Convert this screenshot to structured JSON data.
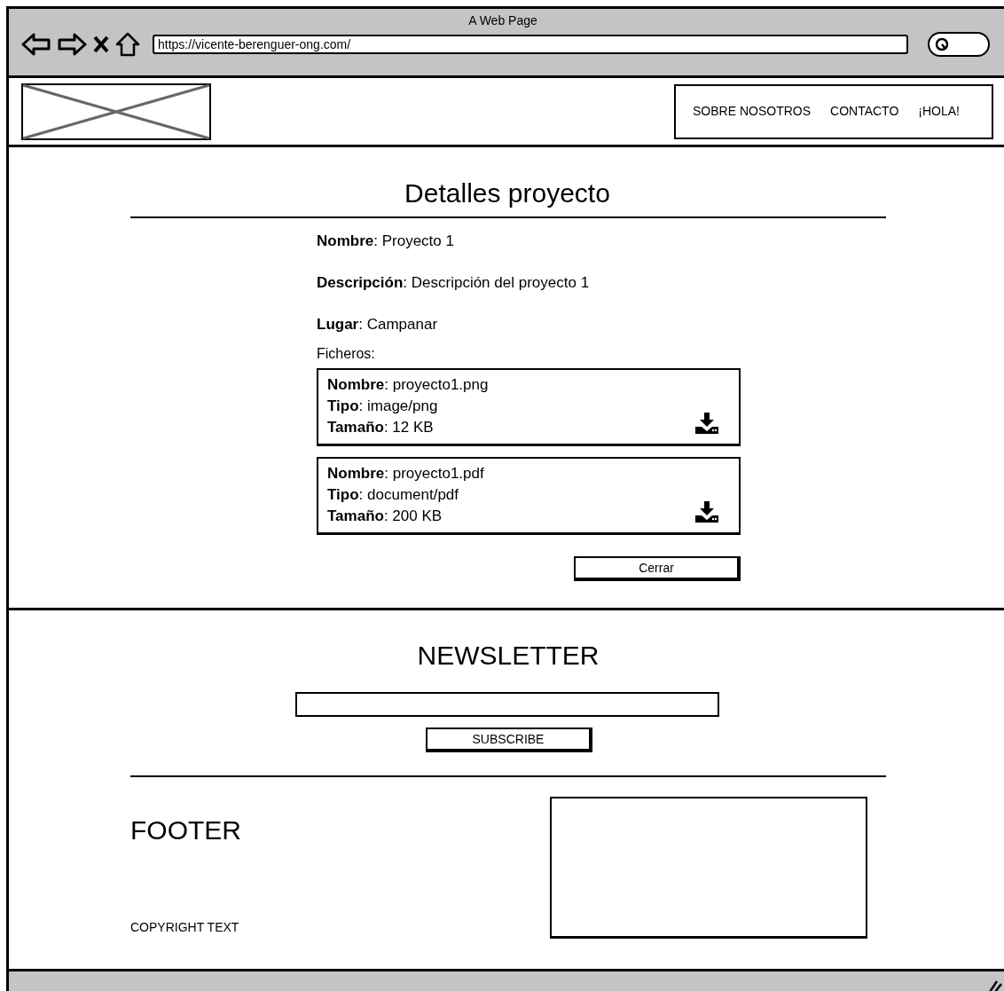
{
  "window": {
    "title": "A Web Page",
    "url": "https://vicente-berenguer-ong.com/"
  },
  "nav": [
    "SOBRE NOSOTROS",
    "CONTACTO",
    "¡HOLA!"
  ],
  "details": {
    "title": "Detalles proyecto",
    "fields": [
      "**Nombre**: Proyecto 1",
      "**Descripción**: Descripción del proyecto 1",
      "**Lugar**: Campanar"
    ],
    "files_label": "Ficheros:",
    "files": [
      {
        "lines": [
          "**Nombre**: proyecto1.png",
          "**Tipo**: image/png",
          "**Tamaño**: 12 KB"
        ]
      },
      {
        "lines": [
          "**Nombre**: proyecto1.pdf",
          "**Tipo**: document/pdf",
          "**Tamaño**: 200 KB"
        ]
      }
    ],
    "close_button": "Cerrar"
  },
  "newsletter": {
    "title": "NEWSLETTER",
    "button": "SUBSCRIBE"
  },
  "footer": {
    "title": "FOOTER",
    "copyright": "COPYRIGHT TEXT"
  }
}
